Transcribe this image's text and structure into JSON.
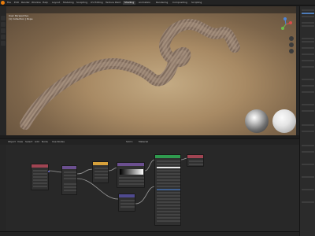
{
  "app": {
    "menu": [
      "File",
      "Edit",
      "Render",
      "Window",
      "Help",
      "Layout",
      "Modeling",
      "Sculpting",
      "UV Editing",
      "Texture Paint",
      "Shading",
      "Animation",
      "Rendering",
      "Compositing",
      "Scripting"
    ],
    "active_workspace": "Shading"
  },
  "viewport": {
    "mode_label": "User Perspective",
    "collection_label": "(1) Collection | Rope",
    "info_line": "Object Mode"
  },
  "node_editor": {
    "header_items": [
      "Object",
      "View",
      "Select",
      "Add",
      "Node",
      "Use Nodes",
      "Slot 1",
      "Material"
    ]
  },
  "colors": {
    "accent": "#e87d0d",
    "node_input": "#a04452",
    "node_texture": "#6b4f8f",
    "node_color": "#d7a13b",
    "node_shader": "#2f9a4e",
    "node_vector": "#4f4a8f",
    "node_output": "#a04452"
  },
  "icons": {
    "logo": "blender-logo-icon",
    "gizmo": "navigation-gizmo-icon"
  }
}
